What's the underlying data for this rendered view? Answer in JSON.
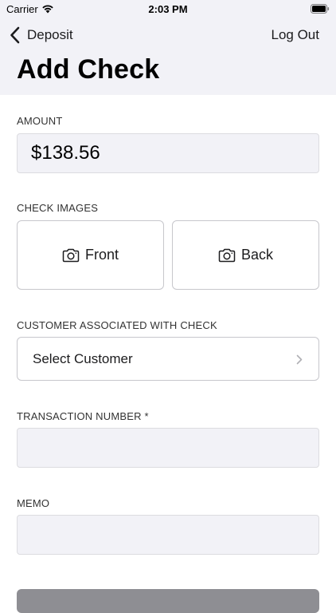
{
  "status_bar": {
    "carrier": "Carrier",
    "time": "2:03 PM"
  },
  "nav": {
    "back_label": "Deposit",
    "logout_label": "Log Out",
    "title": "Add Check"
  },
  "amount": {
    "label": "AMOUNT",
    "value": "$138.56"
  },
  "check_images": {
    "label": "CHECK IMAGES",
    "front_label": "Front",
    "back_label": "Back"
  },
  "customer": {
    "label": "CUSTOMER ASSOCIATED WITH CHECK",
    "placeholder": "Select Customer"
  },
  "transaction": {
    "label": "TRANSACTION NUMBER *",
    "value": ""
  },
  "memo": {
    "label": "MEMO",
    "value": ""
  },
  "colors": {
    "header_bg": "#f2f2f7",
    "field_bg": "#f2f2f7",
    "border": "#c7c7cc",
    "button_bg": "#8e8e93"
  },
  "icons": [
    "wifi-icon",
    "battery-icon",
    "chevron-left-icon",
    "camera-icon",
    "chevron-right-icon"
  ]
}
